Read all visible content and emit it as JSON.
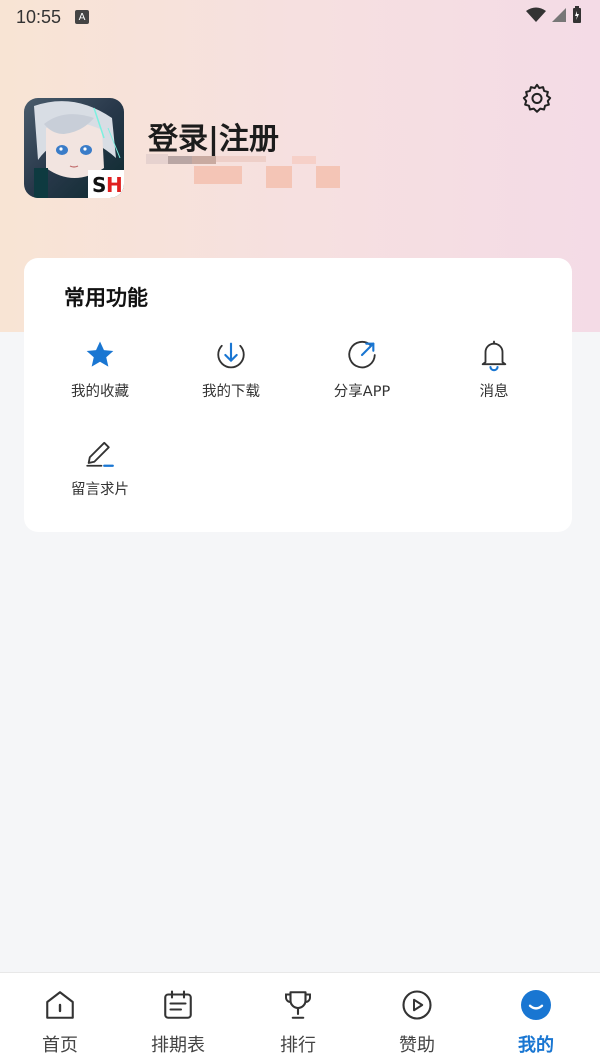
{
  "status_bar": {
    "time": "10:55",
    "notification_icon": "A"
  },
  "profile": {
    "title": "登录|注册"
  },
  "common_functions": {
    "title": "常用功能",
    "items": [
      {
        "label": "我的收藏",
        "icon": "star-icon"
      },
      {
        "label": "我的下载",
        "icon": "download-icon"
      },
      {
        "label": "分享APP",
        "icon": "share-icon"
      },
      {
        "label": "消息",
        "icon": "bell-icon"
      },
      {
        "label": "留言求片",
        "icon": "edit-icon"
      }
    ]
  },
  "tab_bar": {
    "items": [
      {
        "label": "首页",
        "icon": "home-icon"
      },
      {
        "label": "排期表",
        "icon": "calendar-icon"
      },
      {
        "label": "排行",
        "icon": "trophy-icon"
      },
      {
        "label": "赞助",
        "icon": "play-icon"
      },
      {
        "label": "我的",
        "icon": "profile-icon",
        "active": true
      }
    ]
  },
  "colors": {
    "accent": "#1976d2",
    "card_bg": "#ffffff",
    "page_bg": "#f5f6f8"
  }
}
